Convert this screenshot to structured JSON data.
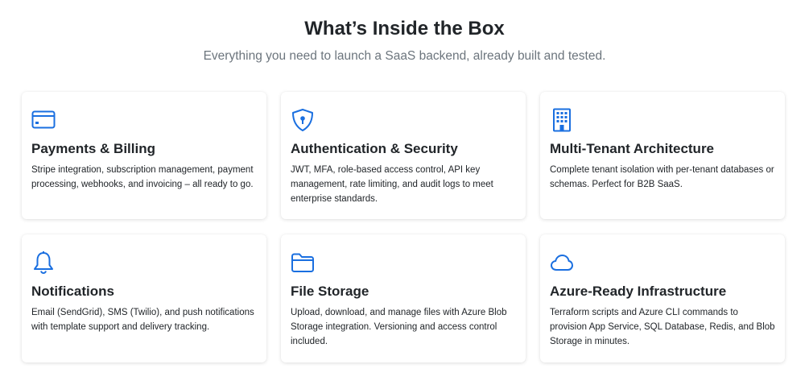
{
  "section": {
    "title": "What’s Inside the Box",
    "subtitle": "Everything you need to launch a SaaS backend, already built and tested."
  },
  "accent_color": "#1a6fe0",
  "features": [
    {
      "icon": "credit-card-icon",
      "title": "Payments & Billing",
      "description": "Stripe integration, subscription management, payment processing, webhooks, and invoicing – all ready to go."
    },
    {
      "icon": "shield-lock-icon",
      "title": "Authentication & Security",
      "description": "JWT, MFA, role-based access control, API key management, rate limiting, and audit logs to meet enterprise standards."
    },
    {
      "icon": "building-icon",
      "title": "Multi-Tenant Architecture",
      "description": "Complete tenant isolation with per-tenant databases or schemas. Perfect for B2B SaaS."
    },
    {
      "icon": "bell-icon",
      "title": "Notifications",
      "description": "Email (SendGrid), SMS (Twilio), and push notifications with template support and delivery tracking."
    },
    {
      "icon": "folder-icon",
      "title": "File Storage",
      "description": "Upload, download, and manage files with Azure Blob Storage integration. Versioning and access control included."
    },
    {
      "icon": "cloud-icon",
      "title": "Azure-Ready Infrastructure",
      "description": "Terraform scripts and Azure CLI commands to provision App Service, SQL Database, Redis, and Blob Storage in minutes."
    }
  ]
}
